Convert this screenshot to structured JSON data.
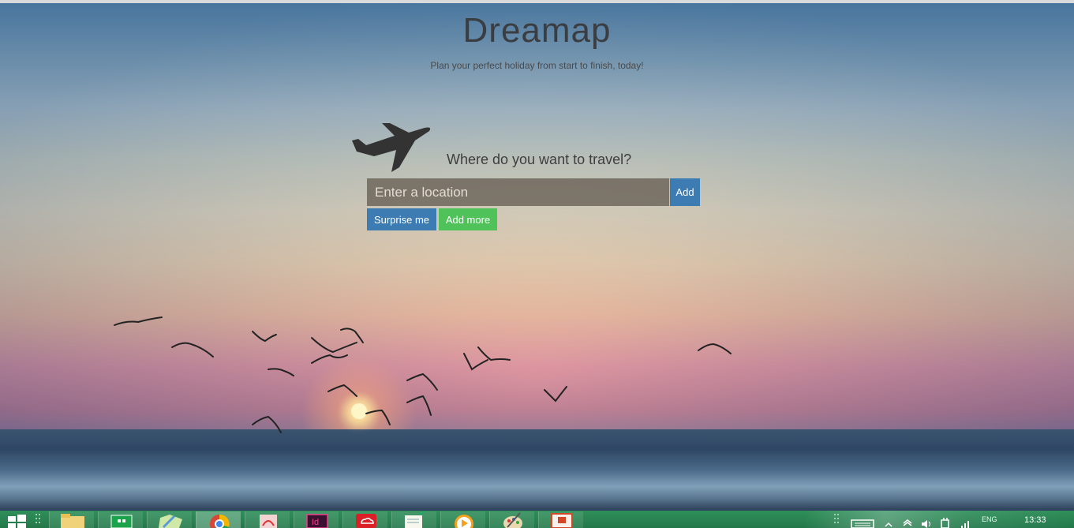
{
  "app": {
    "title": "Dreamap",
    "tagline": "Plan your perfect holiday from start to finish, today!"
  },
  "search": {
    "prompt": "Where do you want to travel?",
    "placeholder": "Enter a location",
    "value": "",
    "add_label": "Add",
    "surprise_label": "Surprise me",
    "add_more_label": "Add more"
  },
  "colors": {
    "primary_button": "#3d7bb3",
    "success_button": "#4fc25a",
    "input_background": "#6e665c",
    "taskbar": "#23784a"
  },
  "taskbar": {
    "apps": [
      {
        "name": "start-icon"
      },
      {
        "name": "file-explorer-icon"
      },
      {
        "name": "store-icon"
      },
      {
        "name": "maps-icon"
      },
      {
        "name": "chrome-icon",
        "active": true
      },
      {
        "name": "acrobat-icon"
      },
      {
        "name": "indesign-icon"
      },
      {
        "name": "creative-cloud-icon"
      },
      {
        "name": "notepad-icon"
      },
      {
        "name": "media-player-icon"
      },
      {
        "name": "paint-icon"
      },
      {
        "name": "powerpoint-icon"
      }
    ],
    "tray": {
      "language": "ENG",
      "time": "13:33"
    }
  }
}
